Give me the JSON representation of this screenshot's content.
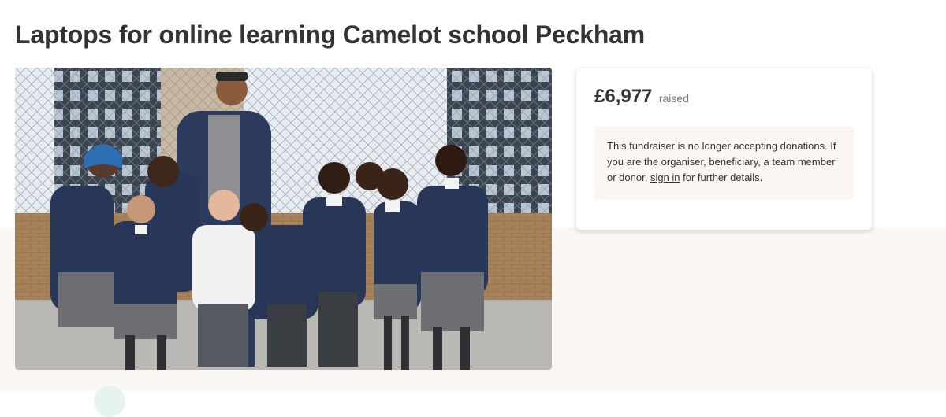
{
  "page": {
    "title": "Laptops for online learning Camelot school Peckham"
  },
  "donation": {
    "amount": "£6,977",
    "raised_label": "raised"
  },
  "notice": {
    "text_before": "This fundraiser is no longer accepting donations. If you are the organiser, beneficiary, a team member or donor, ",
    "sign_in_label": "sign in",
    "text_after": " for further details."
  },
  "colors": {
    "band": "#fbf7f4",
    "notice_bg": "#fbf6f2",
    "text": "#333333",
    "muted": "#767676"
  }
}
